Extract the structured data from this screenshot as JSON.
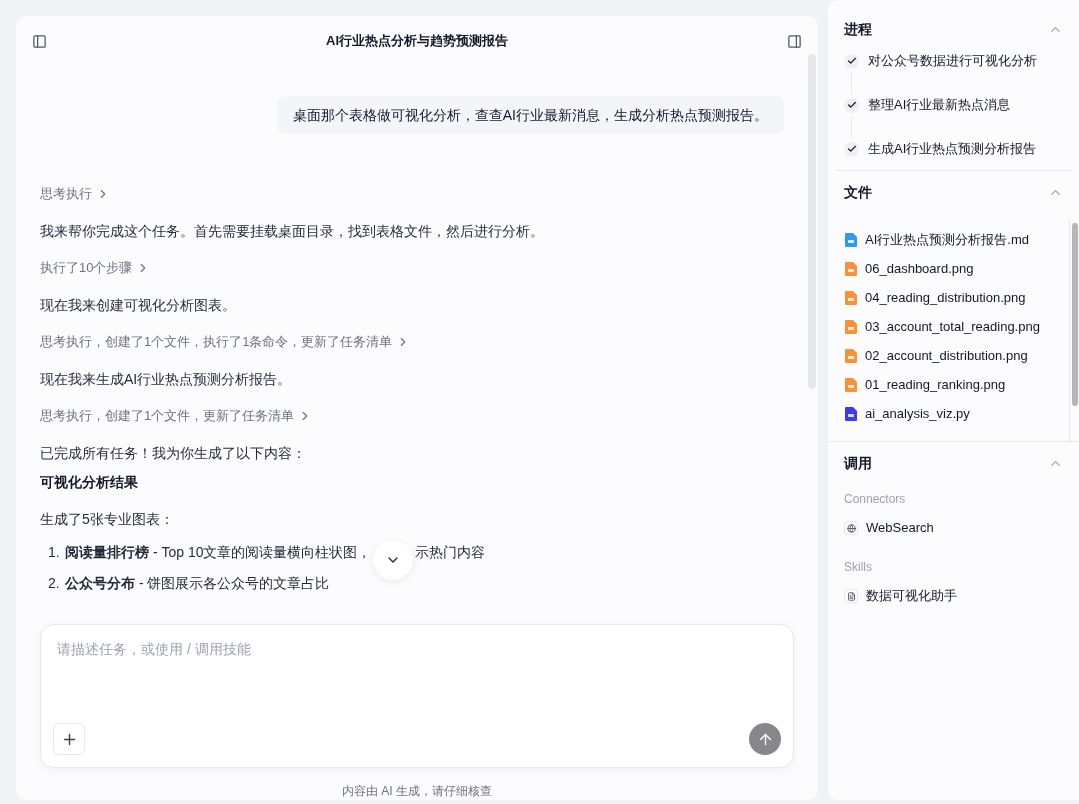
{
  "chat": {
    "title": "AI行业热点分析与趋势预测报告",
    "user_message": "桌面那个表格做可视化分析，查查AI行业最新消息，生成分析热点预测报告。",
    "blocks": [
      {
        "kind": "step",
        "text": "思考执行"
      },
      {
        "kind": "text",
        "text": "我来帮你完成这个任务。首先需要挂载桌面目录，找到表格文件，然后进行分析。"
      },
      {
        "kind": "step",
        "text": "执行了10个步骤"
      },
      {
        "kind": "text",
        "text": "现在我来创建可视化分析图表。"
      },
      {
        "kind": "step",
        "text": "思考执行，创建了1个文件，执行了1条命令，更新了任务清单"
      },
      {
        "kind": "text",
        "text": "现在我来生成AI行业热点预测分析报告。"
      },
      {
        "kind": "step",
        "text": "思考执行，创建了1个文件，更新了任务清单"
      },
      {
        "kind": "text",
        "text": "已完成所有任务！我为你生成了以下内容："
      },
      {
        "kind": "heading",
        "text": "可视化分析结果"
      },
      {
        "kind": "text",
        "text": "生成了5张专业图表："
      }
    ],
    "list": [
      {
        "number": "1.",
        "bold": "阅读量排行榜",
        "text": " - Top 10文章的阅读量横向柱状图，",
        "text_after": "示热门内容"
      },
      {
        "number": "2.",
        "bold": "公众号分布",
        "text": " - 饼图展示各公众号的文章占比"
      }
    ],
    "input": {
      "placeholder": "请描述任务，或使用 / 调用技能"
    },
    "footer": "内容由 AI 生成，请仔细核查"
  },
  "sidebar": {
    "progress": {
      "title": "进程",
      "expanded": true,
      "tasks": [
        {
          "label": "对公众号数据进行可视化分析",
          "done": true
        },
        {
          "label": "整理AI行业最新热点消息",
          "done": true
        },
        {
          "label": "生成AI行业热点预测分析报告",
          "done": true
        }
      ]
    },
    "files": {
      "title": "文件",
      "expanded": true,
      "items": [
        {
          "name": "AI行业热点预测分析报告.md",
          "kind": "md"
        },
        {
          "name": "06_dashboard.png",
          "kind": "image"
        },
        {
          "name": "04_reading_distribution.png",
          "kind": "image"
        },
        {
          "name": "03_account_total_reading.png",
          "kind": "image"
        },
        {
          "name": "02_account_distribution.png",
          "kind": "image"
        },
        {
          "name": "01_reading_ranking.png",
          "kind": "image"
        },
        {
          "name": "ai_analysis_viz.py",
          "kind": "python"
        }
      ]
    },
    "tools": {
      "title": "调用",
      "expanded": true,
      "groups": [
        {
          "label": "Connectors",
          "items": [
            {
              "name": "WebSearch",
              "kind": "connector"
            }
          ]
        },
        {
          "label": "Skills",
          "items": [
            {
              "name": "数据可视化助手",
              "kind": "skill"
            }
          ]
        }
      ]
    }
  }
}
